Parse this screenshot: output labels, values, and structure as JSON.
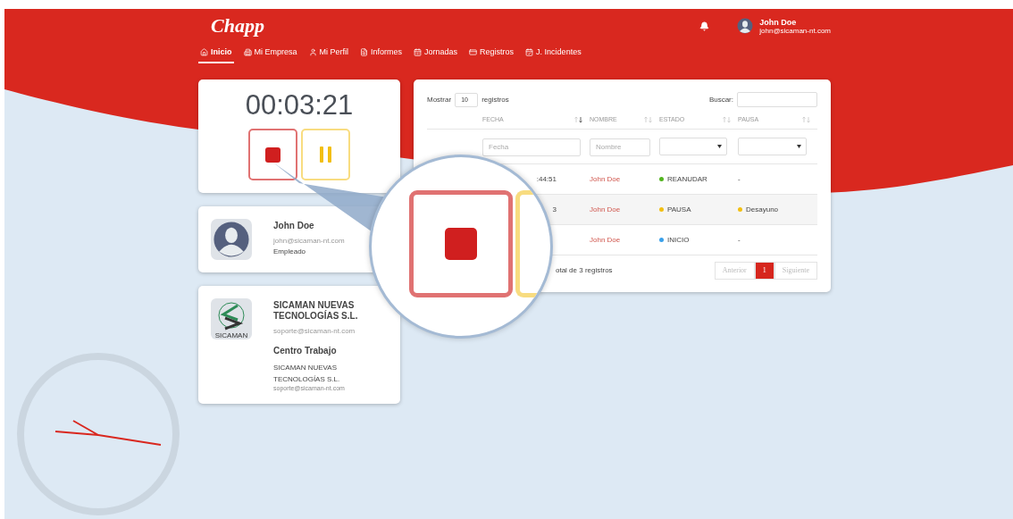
{
  "brand": {
    "logo": "Chapp"
  },
  "user": {
    "name": "John Doe",
    "email": "john@sicaman-nt.com"
  },
  "nav": [
    {
      "label": "Inicio",
      "selected": true
    },
    {
      "label": "Mi Empresa",
      "selected": false
    },
    {
      "label": "Mi Perfil",
      "selected": false
    },
    {
      "label": "Informes",
      "selected": false
    },
    {
      "label": "Jornadas",
      "selected": false
    },
    {
      "label": "Registros",
      "selected": false
    },
    {
      "label": "J. Incidentes",
      "selected": false
    }
  ],
  "timer": {
    "time": "00:03:21"
  },
  "profile": {
    "name": "John Doe",
    "email": "john@sicaman-nt.com",
    "role": "Empleado"
  },
  "company": {
    "logo_text": "SICAMAN",
    "name": "SICAMAN NUEVAS TECNOLOGÍAS S.L.",
    "email": "soporte@sicaman-nt.com",
    "section_title": "Centro Trabajo",
    "center_name": "SICAMAN NUEVAS TECNOLOGÍAS S.L.",
    "center_email": "soporte@sicaman-nt.com"
  },
  "table": {
    "show_label": "Mostrar",
    "page_size": "10",
    "show_suffix": "registros",
    "search_label": "Buscar:",
    "columns": [
      {
        "label": "FECHA",
        "sorted": true
      },
      {
        "label": "NOMBRE",
        "sorted": false
      },
      {
        "label": "ESTADO",
        "sorted": false
      },
      {
        "label": "PAUSA",
        "sorted": false
      }
    ],
    "filters": [
      {
        "kind": "text",
        "placeholder": "Fecha"
      },
      {
        "kind": "text",
        "placeholder": "Nombre"
      },
      {
        "kind": "select"
      },
      {
        "kind": "select"
      }
    ],
    "rows": [
      {
        "fecha": ":44:51",
        "nombre": "John Doe",
        "estado": {
          "text": "REANUDAR",
          "color": "#52b51f"
        },
        "pausa": {
          "text": "-"
        }
      },
      {
        "fecha": "3",
        "nombre": "John Doe",
        "estado": {
          "text": "PAUSA",
          "color": "#f2bf12"
        },
        "pausa": {
          "text": "Desayuno",
          "color": "#f2bf12"
        }
      },
      {
        "nombre": "John Doe",
        "estado": {
          "text": "INICIO",
          "color": "#3aa0ea"
        },
        "pausa": {
          "text": "-"
        }
      }
    ],
    "info": "otal de 3 registros",
    "pagination": {
      "previous": "Anterior",
      "pages": [
        {
          "label": "1",
          "selected": true
        }
      ],
      "next": "Siguiente"
    }
  }
}
